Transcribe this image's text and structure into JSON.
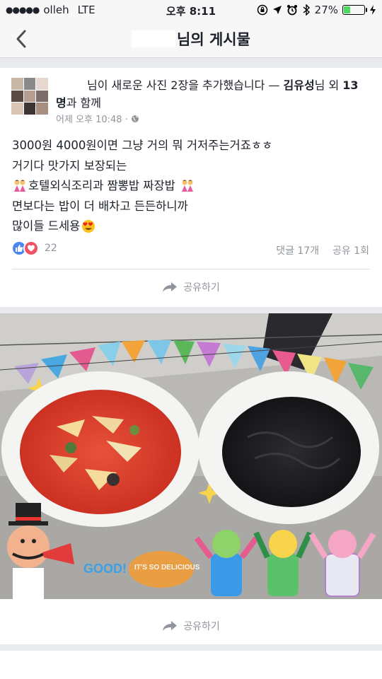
{
  "status_bar": {
    "carrier": "olleh",
    "network": "LTE",
    "time": "오후 8:11",
    "battery": "27%"
  },
  "nav": {
    "title": "님의 게시물"
  },
  "post": {
    "header_text": "님이 새로운 사진 2장을 추가했습니다 — ",
    "tagged_name": "김유성",
    "header_suffix": "님 외 ",
    "others": "13명",
    "header_end": "과 함께",
    "timestamp": "어제 오후 10:48 ·",
    "lines": [
      "3000원 4000원이면 그냥 거의 뭐 거저주는거죠ㅎㅎ",
      "거기다 맛가지 보장되는",
      "호텔외식조리과 짬뽕밥 짜장밥",
      "면보다는 밥이 더 배차고 든든하니까",
      "많이들 드세용"
    ],
    "reaction_count": "22",
    "comment_count": "댓글 17개",
    "share_count": "공유 1회",
    "share_label": "공유하기"
  },
  "photo": {
    "sticker_good": "GOOD!",
    "sticker_delicious": "IT'S SO DELICIOUS"
  },
  "photo_card": {
    "share_label": "공유하기"
  },
  "colors": {
    "like_blue": "#4c84f4",
    "love_red": "#f25268",
    "meta_gray": "#90949c"
  }
}
